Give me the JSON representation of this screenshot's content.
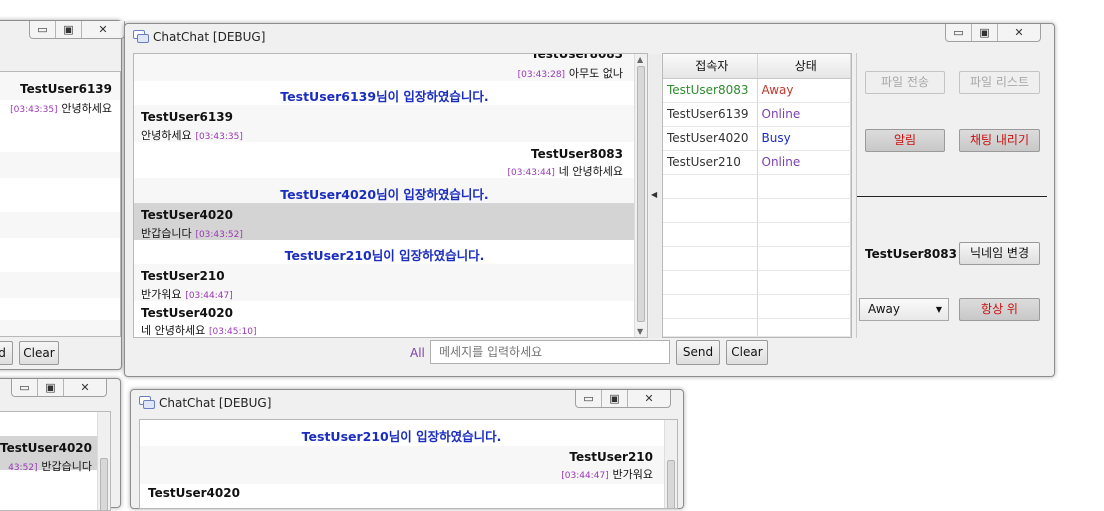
{
  "colors": {
    "system": "#1a2dbf",
    "timestamp": "#9a38b6",
    "away": "#c0392b",
    "online": "#7b3fb0",
    "busy": "#1a2dbf",
    "green": "#2e8b2e",
    "warn": "#cc1010"
  },
  "left_window": {
    "visible_name": "TestUser6139",
    "visible_ts": "[03:43:35]",
    "visible_msg": "안녕하세요",
    "partial_btn": "d",
    "clear_btn": "Clear"
  },
  "main_window": {
    "title": "ChatChat [DEBUG]",
    "chat": {
      "top_partial_name": "TestUser8083",
      "top_ts": "[03:43:28]",
      "top_msg": "아무도 없나",
      "sys1": "TestUser6139님이 입장하였습니다.",
      "m1_name": "TestUser6139",
      "m1_msg": "안녕하세요",
      "m1_ts": "[03:43:35]",
      "m2_name": "TestUser8083",
      "m2_ts": "[03:43:44]",
      "m2_msg": "네 안녕하세요",
      "sys2": "TestUser4020님이 입장하였습니다.",
      "m3_name": "TestUser4020",
      "m3_msg": "반갑습니다",
      "m3_ts": "[03:43:52]",
      "sys3": "TestUser210님이 입장하였습니다.",
      "m4_name": "TestUser210",
      "m4_msg": "반가워요",
      "m4_ts": "[03:44:47]",
      "m5_name": "TestUser4020",
      "m5_msg": "네 안녕하세요",
      "m5_ts": "[03:45:10]"
    },
    "users": {
      "col_user": "접속자",
      "col_status": "상태",
      "rows": [
        {
          "name": "TestUser8083",
          "status": "Away"
        },
        {
          "name": "TestUser6139",
          "status": "Online"
        },
        {
          "name": "TestUser4020",
          "status": "Busy"
        },
        {
          "name": "TestUser210",
          "status": "Online"
        }
      ]
    },
    "side": {
      "file_send": "파일 전송",
      "file_list": "파일 리스트",
      "alarm": "알림",
      "clear_chat": "채팅 내리기",
      "my_name": "TestUser8083",
      "change_nick": "닉네임 변경",
      "status_select": "Away",
      "always_top": "항상 위"
    },
    "input": {
      "target": "All",
      "placeholder": "메세지를 입력하세요",
      "send": "Send",
      "clear": "Clear"
    }
  },
  "bottom_left_window": {
    "name": "TestUser4020",
    "ts": "43:52]",
    "msg": "반갑습니다"
  },
  "bottom_window": {
    "title": "ChatChat [DEBUG]",
    "sys": "TestUser210님이 입장하였습니다.",
    "m1_name": "TestUser210",
    "m1_ts": "[03:44:47]",
    "m1_msg": "반가워요",
    "m2_name": "TestUser4020"
  }
}
